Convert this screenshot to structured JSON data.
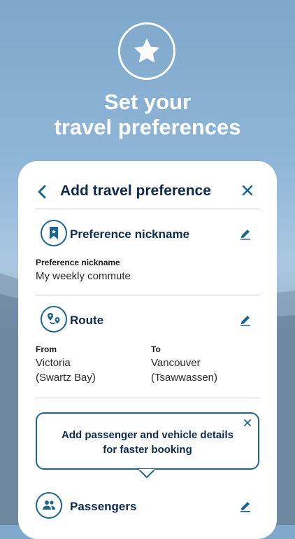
{
  "hero": {
    "icon": "star-icon",
    "title_line1": "Set your",
    "title_line2": "travel preferences"
  },
  "header": {
    "back_icon": "chevron-left-icon",
    "title": "Add travel preference",
    "close_icon": "close-icon"
  },
  "nickname_section": {
    "icon": "bookmark-icon",
    "title": "Preference nickname",
    "edit_icon": "pencil-icon",
    "field_label": "Preference nickname",
    "field_value": "My weekly commute"
  },
  "route_section": {
    "icon": "route-icon",
    "title": "Route",
    "edit_icon": "pencil-icon",
    "from_label": "From",
    "from_line1": "Victoria",
    "from_line2": "(Swartz Bay)",
    "to_label": "To",
    "to_line1": "Vancouver",
    "to_line2": "(Tsawwassen)"
  },
  "tooltip": {
    "line1": "Add passenger and vehicle details",
    "line2": "for faster booking",
    "close_icon": "close-icon"
  },
  "passengers_section": {
    "icon": "people-icon",
    "title": "Passengers",
    "edit_icon": "pencil-icon"
  },
  "colors": {
    "accent": "#1a6690",
    "heading": "#0d2b4e"
  }
}
